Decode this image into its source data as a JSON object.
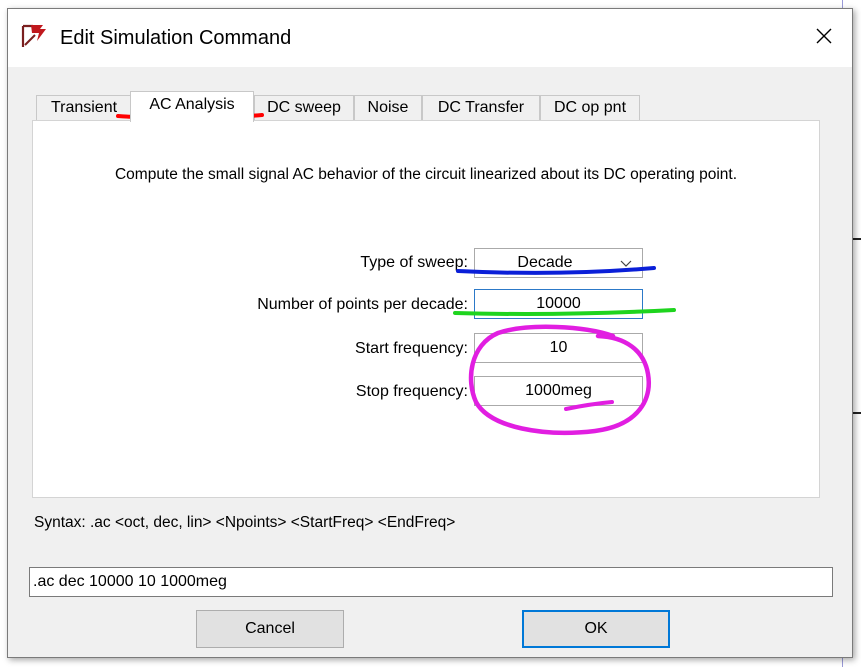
{
  "window": {
    "title": "Edit Simulation Command",
    "close_glyph": "✕"
  },
  "tabs": [
    {
      "label": "Transient",
      "active": false
    },
    {
      "label": "AC Analysis",
      "active": true
    },
    {
      "label": "DC sweep",
      "active": false
    },
    {
      "label": "Noise",
      "active": false
    },
    {
      "label": "DC Transfer",
      "active": false
    },
    {
      "label": "DC op pnt",
      "active": false
    }
  ],
  "panel": {
    "description": "Compute the small signal AC behavior of the circuit linearized about its DC operating point.",
    "sweep_type_label": "Type of sweep:",
    "sweep_type_value": "Decade",
    "points_label": "Number of points per decade:",
    "points_value": "10000",
    "start_label": "Start frequency:",
    "start_value": "10",
    "stop_label": "Stop frequency:",
    "stop_value": "1000meg"
  },
  "syntax": "Syntax:  .ac <oct, dec, lin> <Npoints> <StartFreq> <EndFreq>",
  "command_value": ".ac dec 10000 10 1000meg",
  "buttons": {
    "cancel": "Cancel",
    "ok": "OK"
  },
  "icons": {
    "app": "ltspice-logo-icon",
    "dropdown": "chevron-down-icon",
    "close": "close-icon"
  },
  "colors": {
    "annotation_red": "#ff0000",
    "annotation_blue": "#0a1fd8",
    "annotation_green": "#1ed41e",
    "annotation_magenta": "#e11ee1",
    "focus_blue": "#0078d7"
  }
}
